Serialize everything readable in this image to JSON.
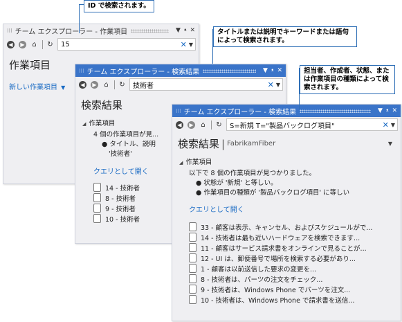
{
  "callouts": {
    "id_search": "ID で検索されます。",
    "keyword_search": "タイトルまたは説明でキーワードまたは語句によって検索されます。",
    "field_search": "担当者、作成者、状態、または作業項目の種類によって検索されます。"
  },
  "window1": {
    "title": "チーム エクスプローラー - 作業項目",
    "search_value": "15",
    "heading": "作業項目",
    "new_item_link": "新しい作業項目"
  },
  "window2": {
    "title": "チーム エクスプローラー - 検索結果",
    "search_value": "技術者",
    "heading": "検索結果",
    "section": "作業項目",
    "summary": "4 個の作業項目が見...",
    "bullet1": "タイトル、説明",
    "bullet1b": "'技術者'",
    "open_as_query": "クエリとして開く",
    "items": [
      "14 - 技術者",
      "8 - 技術者",
      "9 - 技術者",
      "10 - 技術者"
    ]
  },
  "window3": {
    "title": "チーム エクスプローラー - 検索結果",
    "search_value": "S=新規 T=\"製品バックログ項目\"",
    "heading": "検索結果",
    "project": "FabrikamFiber",
    "section": "作業項目",
    "summary": "以下で 8 個の作業項目が見つかりました。",
    "bullet1": "状態が '新規' と等しい。",
    "bullet2": "作業項目の種類が '製品バックログ項目' に等しい",
    "open_as_query": "クエリとして開く",
    "items": [
      "33 - 顧客は表示、キャンセル、およびスケジュールがで...",
      "14 - 技術者は最も近いハードウェアを検索できます...",
      "11 - 顧客はサービス請求書をオンラインで見ることが...",
      "12 - UI は、郵便番号で場所を検索する必要があり...",
      "1 - 顧客は以前送信した要求の変更を...",
      "8 - 技術者は、パーツの注文をチェック...",
      "9 - 技術者は、Windows Phone でパーツを注文...",
      "10 - 技術者は、Windows Phone で請求書を送信..."
    ]
  }
}
